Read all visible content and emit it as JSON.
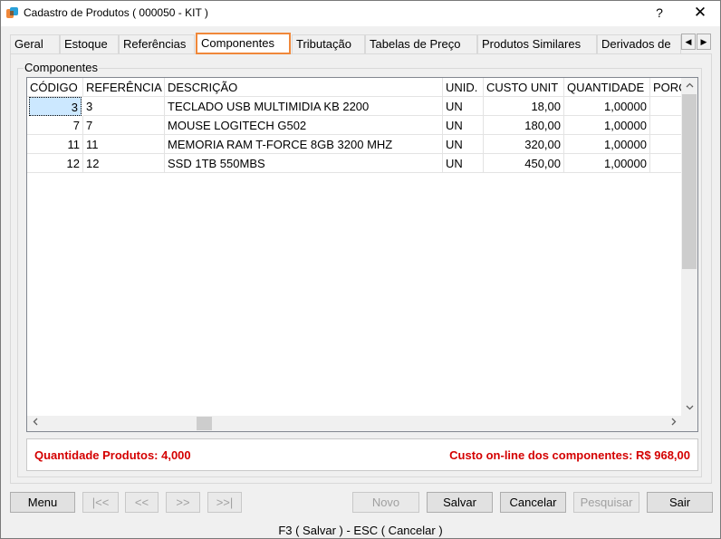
{
  "window": {
    "title": "Cadastro de Produtos ( 000050 - KIT )",
    "help": "?",
    "close": "✕"
  },
  "tabs": [
    {
      "label": "Geral"
    },
    {
      "label": "Estoque"
    },
    {
      "label": "Referências"
    },
    {
      "label": "Componentes",
      "active": true
    },
    {
      "label": "Tributação"
    },
    {
      "label": "Tabelas de Preço"
    },
    {
      "label": "Produtos Similares"
    },
    {
      "label": "Derivados de"
    }
  ],
  "tab_scroll": {
    "left": "◀",
    "right": "▶"
  },
  "group": {
    "label": "Componentes"
  },
  "grid": {
    "columns": [
      "CÓDIGO",
      "REFERÊNCIA",
      "DESCRIÇÃO",
      "UNID.",
      "CUSTO UNIT",
      "QUANTIDADE",
      "PORC"
    ],
    "rows": [
      {
        "codigo": "3",
        "referencia": "3",
        "descricao": "TECLADO USB MULTIMIDIA KB 2200",
        "unid": "UN",
        "custo": "18,00",
        "quantidade": "1,00000"
      },
      {
        "codigo": "7",
        "referencia": "7",
        "descricao": "MOUSE LOGITECH G502",
        "unid": "UN",
        "custo": "180,00",
        "quantidade": "1,00000"
      },
      {
        "codigo": "11",
        "referencia": "11",
        "descricao": "MEMORIA RAM T-FORCE 8GB 3200 MHZ",
        "unid": "UN",
        "custo": "320,00",
        "quantidade": "1,00000"
      },
      {
        "codigo": "12",
        "referencia": "12",
        "descricao": "SSD 1TB 550MBS",
        "unid": "UN",
        "custo": "450,00",
        "quantidade": "1,00000"
      }
    ]
  },
  "summary": {
    "quantidade": "Quantidade Produtos: 4,000",
    "custo": "Custo on-line dos componentes: R$ 968,00"
  },
  "buttons": {
    "menu": "Menu",
    "first": "|<<",
    "prev": "<<",
    "next": ">>",
    "last": ">>|",
    "novo": "Novo",
    "salvar": "Salvar",
    "cancelar": "Cancelar",
    "pesquisar": "Pesquisar",
    "sair": "Sair"
  },
  "status": "F3 ( Salvar )   -   ESC ( Cancelar )",
  "colors": {
    "accent": "#f0883a",
    "summary_text": "#d40000",
    "selection": "#cce8ff"
  }
}
